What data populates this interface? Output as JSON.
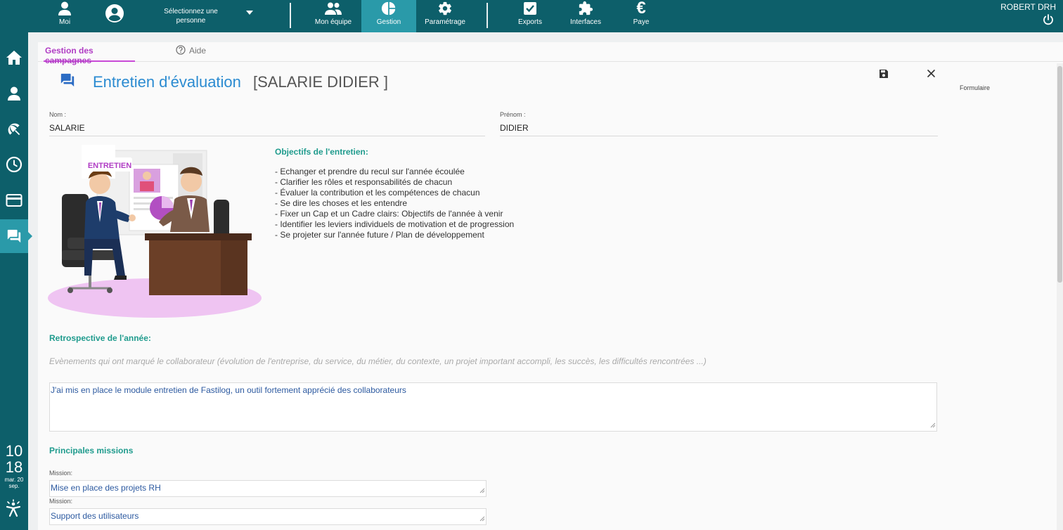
{
  "topbar": {
    "moi_label": "Moi",
    "person_select_label": "Sélectionnez une personne",
    "nav": [
      {
        "label": "Mon équipe"
      },
      {
        "label": "Gestion"
      },
      {
        "label": "Paramétrage"
      },
      {
        "label": "Exports"
      },
      {
        "label": "Interfaces"
      },
      {
        "label": "Paye"
      }
    ],
    "user_name": "ROBERT DRH"
  },
  "sidebar": {
    "clock": {
      "hours": "10",
      "minutes": "18",
      "date": "mar. 20 sep."
    }
  },
  "tabs": [
    {
      "label": "Gestion des campagnes"
    },
    {
      "label": "Aide"
    }
  ],
  "header": {
    "title": "Entretien d'évaluation",
    "subtitle": "[SALARIE DIDIER ]",
    "side_label": "Formulaire"
  },
  "form": {
    "nom_label": "Nom :",
    "nom_value": "SALARIE",
    "prenom_label": "Prénom :",
    "prenom_value": "DIDIER"
  },
  "illustration": {
    "badge_text": "ENTRETIEN"
  },
  "objectives": {
    "title": "Objectifs de l'entretien:",
    "items": [
      "- Echanger et prendre du recul sur l'année écoulée",
      "- Clarifier les rôles et responsabilités de chacun",
      "- Évaluer la contribution et les compétences de chacun",
      "- Se dire les choses et les entendre",
      "- Fixer un Cap et un Cadre clairs: Objectifs de l'année à venir",
      "- Identifier les leviers individuels de motivation et de progression",
      "- Se projeter sur l'année future / Plan de développement"
    ]
  },
  "retrospective": {
    "title": "Retrospective de l'année:",
    "hint": "Evènements qui ont marqué le collaborateur (évolution de l'entreprise, du service, du métier, du contexte, un projet important accompli, les succès, les difficultés rencontrées ...)",
    "value": "J'ai mis en place le module entretien de Fastilog, un outil fortement apprécié des collaborateurs"
  },
  "missions": {
    "title": "Principales missions",
    "items": [
      {
        "label": "Mission:",
        "value": "Mise en place des projets RH"
      },
      {
        "label": "Mission:",
        "value": "Support des utilisateurs"
      }
    ]
  },
  "colors": {
    "bar": "#0d5f6a",
    "active": "#2a9aa9",
    "accent_purple": "#c84ad7",
    "title_blue": "#2b8bd1",
    "section_teal": "#1f9b8d"
  }
}
